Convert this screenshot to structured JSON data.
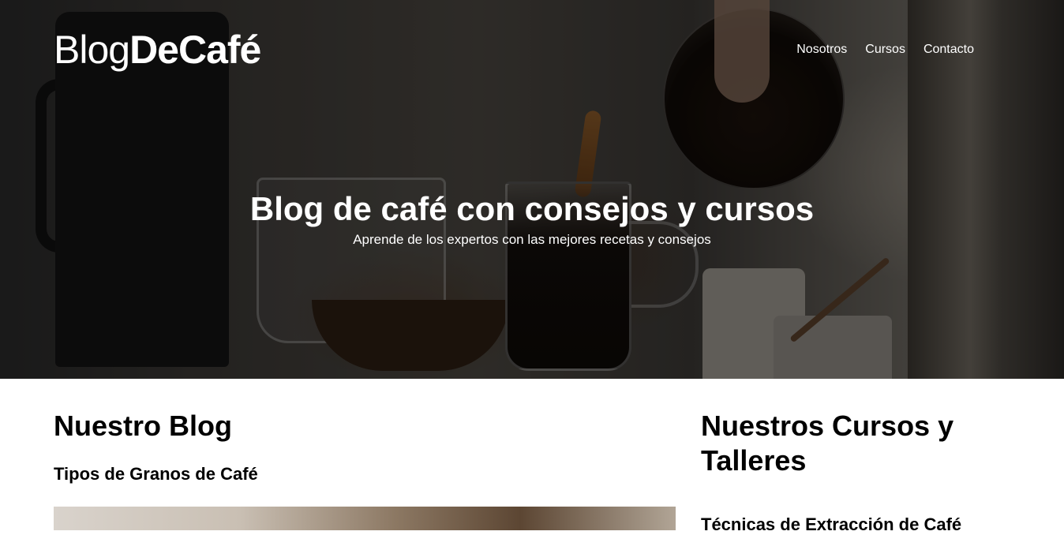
{
  "header": {
    "logo_light": "Blog",
    "logo_bold": "DeCafé",
    "nav": [
      "Nosotros",
      "Cursos",
      "Contacto"
    ]
  },
  "hero": {
    "title": "Blog de café con consejos y cursos",
    "subtitle": "Aprende de los expertos con las mejores recetas y consejos"
  },
  "blog": {
    "title": "Nuestro Blog",
    "posts": [
      {
        "title": "Tipos de Granos de Café"
      }
    ]
  },
  "courses": {
    "title": "Nuestros Cursos y Talleres",
    "items": [
      {
        "title": "Técnicas de Extracción de Café"
      }
    ]
  },
  "colors": {
    "text_light": "#ffffff",
    "text_dark": "#000000",
    "background": "#ffffff"
  }
}
